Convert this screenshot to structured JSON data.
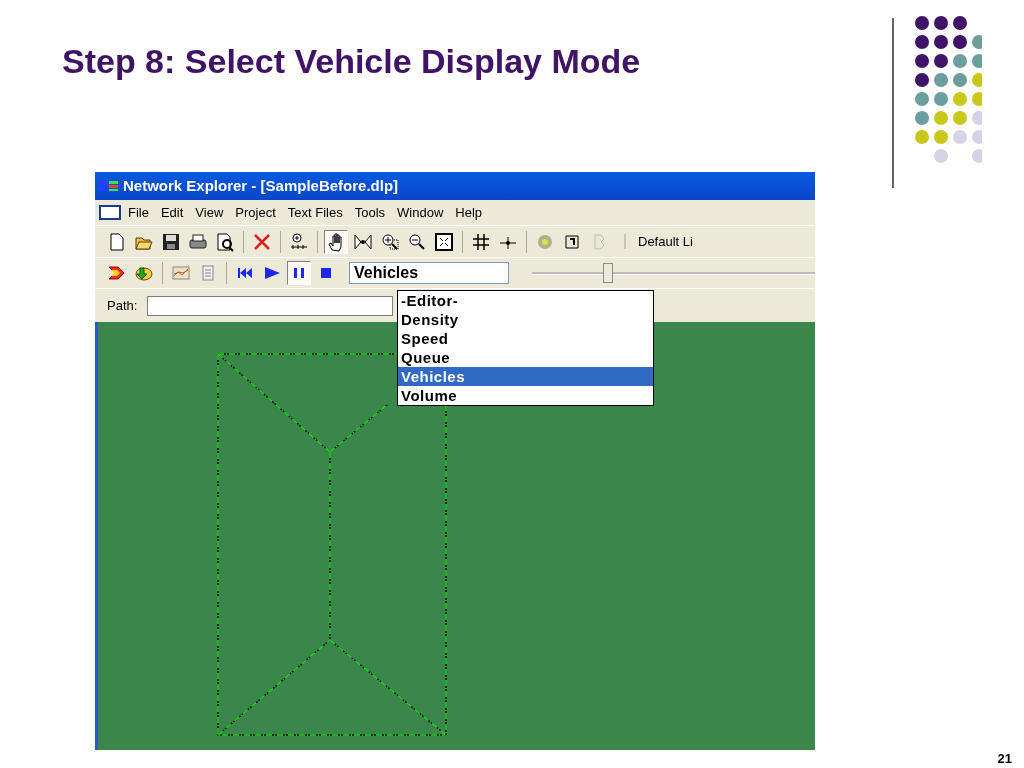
{
  "slide": {
    "title": "Step 8: Select Vehicle Display Mode",
    "page_number": "21"
  },
  "window": {
    "title": "Network Explorer - [SampleBefore.dlp]"
  },
  "menu": [
    "File",
    "Edit",
    "View",
    "Project",
    "Text Files",
    "Tools",
    "Window",
    "Help"
  ],
  "toolbar": [
    {
      "kind": "new",
      "pressed": false
    },
    {
      "kind": "open",
      "pressed": false
    },
    {
      "kind": "save",
      "pressed": false
    },
    {
      "kind": "print",
      "pressed": false
    },
    {
      "kind": "preview",
      "pressed": false
    },
    {
      "kind": "separator"
    },
    {
      "kind": "delete",
      "pressed": false
    },
    {
      "kind": "separator"
    },
    {
      "kind": "add-node",
      "pressed": false
    },
    {
      "kind": "separator"
    },
    {
      "kind": "hand",
      "pressed": true
    },
    {
      "kind": "zoom-box",
      "pressed": false
    },
    {
      "kind": "zoom-in",
      "pressed": false
    },
    {
      "kind": "zoom-out",
      "pressed": false
    },
    {
      "kind": "fit",
      "pressed": false
    },
    {
      "kind": "separator"
    },
    {
      "kind": "grid",
      "pressed": false
    },
    {
      "kind": "point",
      "pressed": false
    },
    {
      "kind": "separator"
    },
    {
      "kind": "coin",
      "pressed": false
    },
    {
      "kind": "sigma",
      "pressed": false
    },
    {
      "kind": "faded",
      "pressed": false
    }
  ],
  "style_dropdown": "Default Li",
  "playback_toolbar": [
    {
      "kind": "run",
      "pressed": false
    },
    {
      "kind": "import",
      "pressed": false
    },
    {
      "kind": "separator"
    },
    {
      "kind": "chart",
      "pressed": false
    },
    {
      "kind": "page",
      "pressed": false
    },
    {
      "kind": "separator"
    },
    {
      "kind": "rewind",
      "pressed": false
    },
    {
      "kind": "play",
      "pressed": false
    },
    {
      "kind": "pause",
      "pressed": true
    },
    {
      "kind": "stop",
      "pressed": false
    }
  ],
  "mode_combo": "Vehicles",
  "speed_slider": {
    "level": 0.25
  },
  "path_bar": {
    "label": "Path:"
  },
  "dropdown": [
    {
      "label": "-Editor-",
      "selected": false
    },
    {
      "label": "Density",
      "selected": false
    },
    {
      "label": "Speed",
      "selected": false
    },
    {
      "label": "Queue",
      "selected": false
    },
    {
      "label": "Vehicles",
      "selected": true
    },
    {
      "label": "Volume",
      "selected": false
    }
  ]
}
